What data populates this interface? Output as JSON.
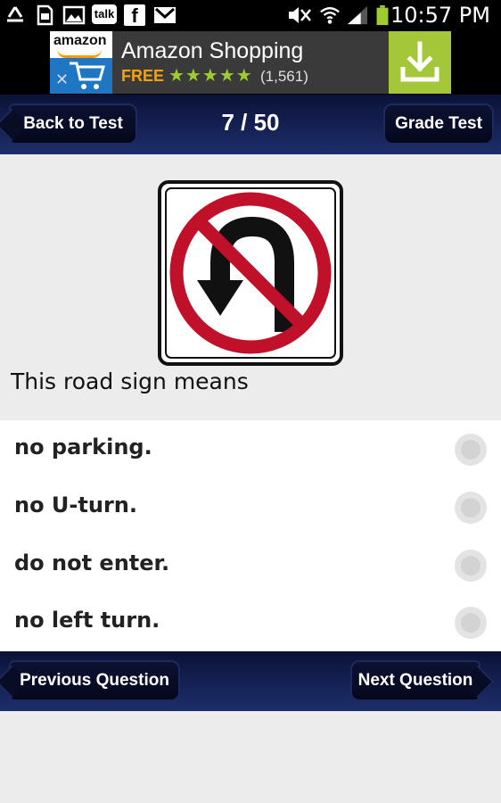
{
  "status_bar": {
    "time": "10:57 PM",
    "talk_label": "talk",
    "icons": [
      "recycle-icon",
      "sd-card-icon",
      "image-icon",
      "talk-icon",
      "facebook-icon",
      "gmail-icon",
      "mute-icon",
      "wifi-icon",
      "signal-icon",
      "battery-icon"
    ]
  },
  "ad": {
    "logo_text": "amazon",
    "title": "Amazon Shopping",
    "price": "FREE",
    "rating": 4.5,
    "stars": "★★★★★",
    "review_count": "(1,561)",
    "close_symbol": "✕",
    "accent_color": "#a4c639"
  },
  "header": {
    "back_label": "Back to Test",
    "counter": "7 / 50",
    "grade_label": "Grade Test"
  },
  "question": {
    "text": "This road sign means",
    "sign_icon": "no-u-turn-sign"
  },
  "answers": [
    {
      "label": "no parking."
    },
    {
      "label": "no U-turn."
    },
    {
      "label": "do not enter."
    },
    {
      "label": "no left turn."
    }
  ],
  "footer": {
    "prev_label": "Previous Question",
    "next_label": "Next Question"
  },
  "colors": {
    "nav_bar": "#0b1236",
    "button": "#05081c",
    "sign_red": "#c0102a"
  }
}
